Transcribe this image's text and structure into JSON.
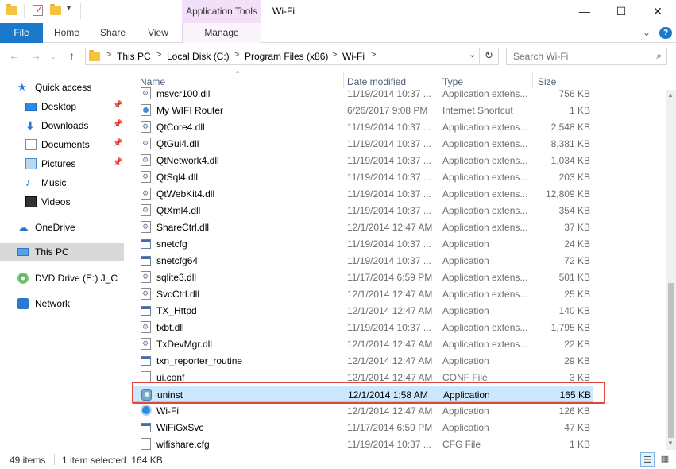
{
  "window": {
    "title": "Wi-Fi",
    "context_tab": "Application Tools",
    "minimize": "—",
    "maximize": "☐",
    "close": "✕"
  },
  "ribbon": {
    "tabs": [
      "File",
      "Home",
      "Share",
      "View",
      "Manage"
    ],
    "expand": "⌄",
    "help": "?"
  },
  "address": {
    "crumbs": [
      "This PC",
      "Local Disk (C:)",
      "Program Files (x86)",
      "Wi-Fi"
    ],
    "separator": ">",
    "dropdown": "⌄",
    "refresh": "↻"
  },
  "search": {
    "placeholder": "Search Wi-Fi"
  },
  "navigation": {
    "items": [
      {
        "label": "Quick access",
        "icon": "star-icon",
        "pinned": false
      },
      {
        "label": "Desktop",
        "icon": "desktop-icon",
        "pinned": true
      },
      {
        "label": "Downloads",
        "icon": "download-icon",
        "pinned": true
      },
      {
        "label": "Documents",
        "icon": "document-icon",
        "pinned": true
      },
      {
        "label": "Pictures",
        "icon": "picture-icon",
        "pinned": true
      },
      {
        "label": "Music",
        "icon": "music-icon",
        "pinned": false
      },
      {
        "label": "Videos",
        "icon": "video-icon",
        "pinned": false
      },
      {
        "label": "OneDrive",
        "icon": "cloud-icon",
        "pinned": false
      },
      {
        "label": "This PC",
        "icon": "computer-icon",
        "pinned": false
      },
      {
        "label": "DVD Drive (E:) J_CENA",
        "icon": "dvd-icon",
        "pinned": false
      },
      {
        "label": "Network",
        "icon": "network-icon",
        "pinned": false
      }
    ],
    "selected": "This PC"
  },
  "columns": {
    "name": "Name",
    "date": "Date modified",
    "type": "Type",
    "size": "Size"
  },
  "files": [
    {
      "name": "msvcr100.dll",
      "date": "11/19/2014 10:37 ...",
      "type": "Application extens...",
      "size": "756 KB",
      "icon": "dll"
    },
    {
      "name": "My WIFI Router",
      "date": "6/26/2017 9:08 PM",
      "type": "Internet Shortcut",
      "size": "1 KB",
      "icon": "url"
    },
    {
      "name": "QtCore4.dll",
      "date": "11/19/2014 10:37 ...",
      "type": "Application extens...",
      "size": "2,548 KB",
      "icon": "dll"
    },
    {
      "name": "QtGui4.dll",
      "date": "11/19/2014 10:37 ...",
      "type": "Application extens...",
      "size": "8,381 KB",
      "icon": "dll"
    },
    {
      "name": "QtNetwork4.dll",
      "date": "11/19/2014 10:37 ...",
      "type": "Application extens...",
      "size": "1,034 KB",
      "icon": "dll"
    },
    {
      "name": "QtSql4.dll",
      "date": "11/19/2014 10:37 ...",
      "type": "Application extens...",
      "size": "203 KB",
      "icon": "dll"
    },
    {
      "name": "QtWebKit4.dll",
      "date": "11/19/2014 10:37 ...",
      "type": "Application extens...",
      "size": "12,809 KB",
      "icon": "dll"
    },
    {
      "name": "QtXml4.dll",
      "date": "11/19/2014 10:37 ...",
      "type": "Application extens...",
      "size": "354 KB",
      "icon": "dll"
    },
    {
      "name": "ShareCtrl.dll",
      "date": "12/1/2014 12:47 AM",
      "type": "Application extens...",
      "size": "37 KB",
      "icon": "dll"
    },
    {
      "name": "snetcfg",
      "date": "11/19/2014 10:37 ...",
      "type": "Application",
      "size": "24 KB",
      "icon": "app"
    },
    {
      "name": "snetcfg64",
      "date": "11/19/2014 10:37 ...",
      "type": "Application",
      "size": "72 KB",
      "icon": "app"
    },
    {
      "name": "sqlite3.dll",
      "date": "11/17/2014 6:59 PM",
      "type": "Application extens...",
      "size": "501 KB",
      "icon": "dll"
    },
    {
      "name": "SvcCtrl.dll",
      "date": "12/1/2014 12:47 AM",
      "type": "Application extens...",
      "size": "25 KB",
      "icon": "dll"
    },
    {
      "name": "TX_Httpd",
      "date": "12/1/2014 12:47 AM",
      "type": "Application",
      "size": "140 KB",
      "icon": "app"
    },
    {
      "name": "txbt.dll",
      "date": "11/19/2014 10:37 ...",
      "type": "Application extens...",
      "size": "1,795 KB",
      "icon": "dll"
    },
    {
      "name": "TxDevMgr.dll",
      "date": "12/1/2014 12:47 AM",
      "type": "Application extens...",
      "size": "22 KB",
      "icon": "dll"
    },
    {
      "name": "txn_reporter_routine",
      "date": "12/1/2014 12:47 AM",
      "type": "Application",
      "size": "29 KB",
      "icon": "app"
    },
    {
      "name": "ui.conf",
      "date": "12/1/2014 12:47 AM",
      "type": "CONF File",
      "size": "3 KB",
      "icon": "txt"
    },
    {
      "name": "uninst",
      "date": "12/1/2014 1:58 AM",
      "type": "Application",
      "size": "165 KB",
      "icon": "uninst",
      "selected": true
    },
    {
      "name": "Wi-Fi",
      "date": "12/1/2014 12:47 AM",
      "type": "Application",
      "size": "126 KB",
      "icon": "wifi"
    },
    {
      "name": "WiFiGxSvc",
      "date": "11/17/2014 6:59 PM",
      "type": "Application",
      "size": "47 KB",
      "icon": "app"
    },
    {
      "name": "wifishare.cfg",
      "date": "11/19/2014 10:37 ...",
      "type": "CFG File",
      "size": "1 KB",
      "icon": "txt"
    }
  ],
  "status": {
    "item_count": "49 items",
    "selection": "1 item selected  164 KB"
  },
  "colors": {
    "accent": "#1979ca",
    "selection": "#cce8ff",
    "highlight": "#e0443c"
  }
}
